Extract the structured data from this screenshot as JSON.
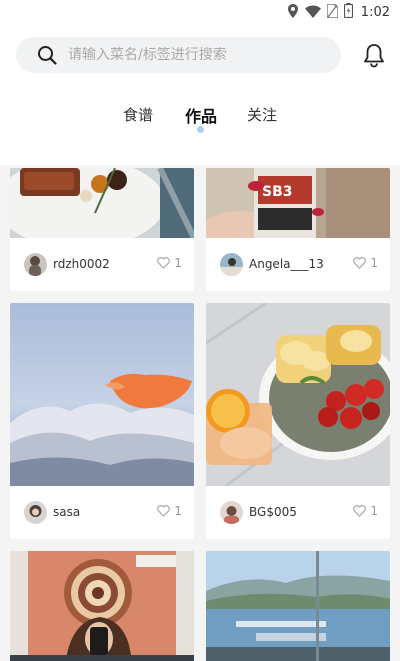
{
  "status": {
    "time": "1:02"
  },
  "search": {
    "placeholder": "请输入菜名/标签进行搜索"
  },
  "tabs": [
    {
      "label": "食谱",
      "active": false
    },
    {
      "label": "作品",
      "active": true
    },
    {
      "label": "关注",
      "active": false
    }
  ],
  "posts": [
    {
      "username": "rdzh0002",
      "likes": "1"
    },
    {
      "username": "Angela___13",
      "likes": "1"
    },
    {
      "username": "sasa",
      "likes": "1"
    },
    {
      "username": "BG$005",
      "likes": "1"
    }
  ],
  "colors": {
    "accent_dot": "#a9d1ee",
    "search_bg": "#f1f2f4",
    "feed_bg": "#f4f4f5"
  }
}
